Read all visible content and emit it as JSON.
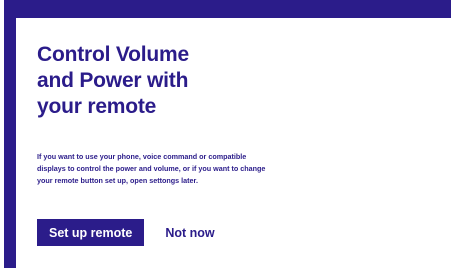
{
  "dialog": {
    "title": "Control Volume\nand Power with\nyour remote",
    "body": "If you want to use your phone, voice command or compatible\n displays to control the power and volume, or if you want to change\nyour remote button set up, open settongs later.",
    "primary_button": "Set up remote",
    "secondary_button": "Not now"
  },
  "colors": {
    "accent": "#2b1c8a",
    "background": "#ffffff"
  }
}
